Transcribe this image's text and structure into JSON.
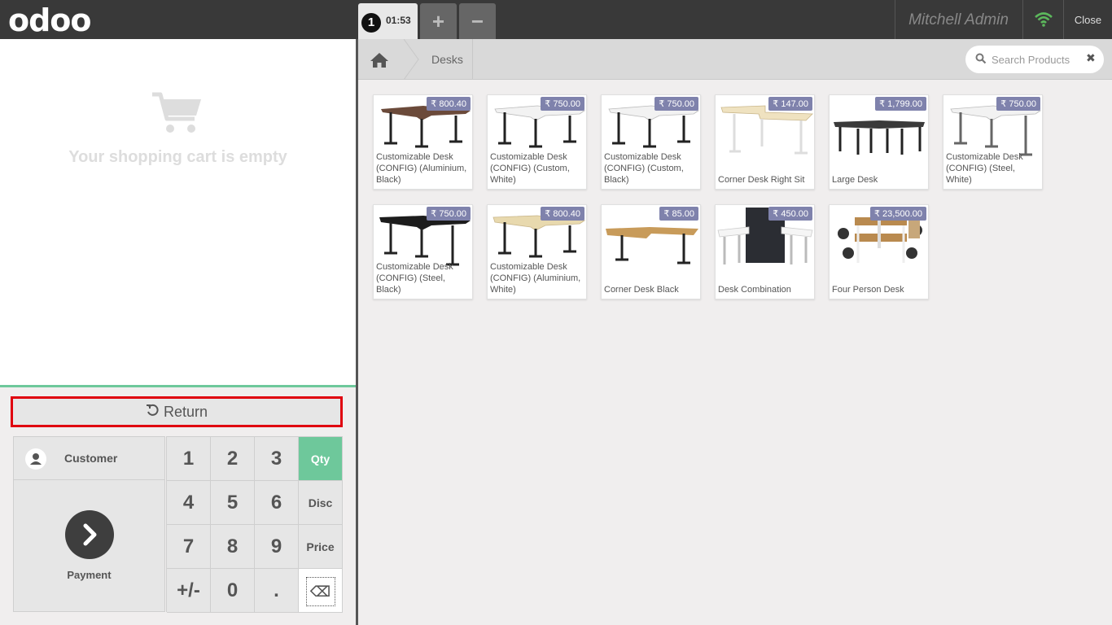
{
  "header": {
    "logo": "odoo",
    "order_number": "1",
    "order_time": "01:53",
    "add_label": "+",
    "remove_label": "−",
    "user": "Mitchell Admin",
    "close_label": "Close"
  },
  "cart": {
    "empty_message": "Your shopping cart is empty",
    "return_label": "Return"
  },
  "actions": {
    "customer_label": "Customer",
    "payment_label": "Payment"
  },
  "numpad": {
    "k1": "1",
    "k2": "2",
    "k3": "3",
    "k4": "4",
    "k5": "5",
    "k6": "6",
    "k7": "7",
    "k8": "8",
    "k9": "9",
    "plusminus": "+/-",
    "k0": "0",
    "dot": ".",
    "qty": "Qty",
    "disc": "Disc",
    "price": "Price",
    "active_mode": "Qty"
  },
  "breadcrumb": {
    "category": "Desks"
  },
  "search": {
    "placeholder": "Search Products"
  },
  "products": [
    {
      "price": "₹ 800.40",
      "name": "Customizable Desk (CONFIG) (Aluminium, Black)"
    },
    {
      "price": "₹ 750.00",
      "name": "Customizable Desk (CONFIG) (Custom, White)"
    },
    {
      "price": "₹ 750.00",
      "name": "Customizable Desk (CONFIG) (Custom, Black)"
    },
    {
      "price": "₹ 147.00",
      "name": "Corner Desk Right Sit"
    },
    {
      "price": "₹ 1,799.00",
      "name": "Large Desk"
    },
    {
      "price": "₹ 750.00",
      "name": "Customizable Desk (CONFIG) (Steel, White)"
    },
    {
      "price": "₹ 750.00",
      "name": "Customizable Desk (CONFIG) (Steel, Black)"
    },
    {
      "price": "₹ 800.40",
      "name": "Customizable Desk (CONFIG) (Aluminium, White)"
    },
    {
      "price": "₹ 85.00",
      "name": "Corner Desk Black"
    },
    {
      "price": "₹ 450.00",
      "name": "Desk Combination"
    },
    {
      "price": "₹ 23,500.00",
      "name": "Four Person Desk"
    }
  ],
  "colors": {
    "header_bg": "#393939",
    "accent_green": "#6ec89b",
    "price_badge": "#7f82ac",
    "highlight_red": "#e0000f",
    "wifi_green": "#5cb85c"
  }
}
